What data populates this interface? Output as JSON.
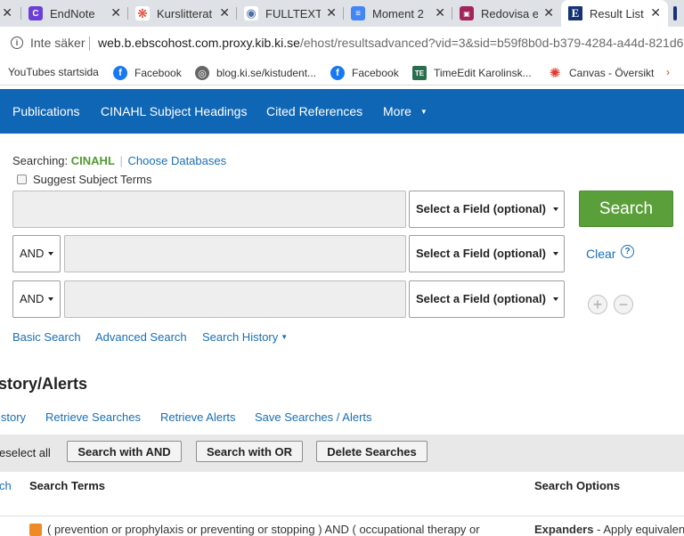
{
  "browser": {
    "tabs": [
      {
        "label": "EndNote",
        "icon": "C",
        "color": "#6a3fd8"
      },
      {
        "label": "Kurslitterat",
        "icon": "❋",
        "color": "#e0392c"
      },
      {
        "label": "FULLTEXT",
        "icon": "◉",
        "color": "#4a6fa5"
      },
      {
        "label": "Moment 2",
        "icon": "≡",
        "color": "#4285f4"
      },
      {
        "label": "Redovisa e",
        "icon": "▣",
        "color": "#a3245a"
      },
      {
        "label": "Result List",
        "icon": "E",
        "color": "#16337a"
      }
    ],
    "address": {
      "security_label": "Inte säker",
      "host": "web.b.ebscohost.com.proxy.kib.ki.se",
      "path": "/ehost/resultsadvanced?vid=3&sid=b59f8b0d-b379-4284-a44d-821d6"
    },
    "bookmarks": [
      {
        "label": "YouTubes startsida"
      },
      {
        "label": "Facebook",
        "icon": "f",
        "color": "#1877f2"
      },
      {
        "label": "blog.ki.se/kistudent...",
        "icon": "◎",
        "color": "#666666"
      },
      {
        "label": "Facebook",
        "icon": "f",
        "color": "#1877f2"
      },
      {
        "label": "TimeEdit Karolinsk...",
        "icon": "TE",
        "color": "#2a6e4f"
      },
      {
        "label": "Canvas - Översikt",
        "icon": "✺",
        "color": "#e0392c"
      }
    ]
  },
  "nav": {
    "items": [
      "Publications",
      "CINAHL Subject Headings",
      "Cited References",
      "More"
    ]
  },
  "search": {
    "searching_label": "Searching:",
    "database": "CINAHL",
    "choose_databases": "Choose Databases",
    "suggest_subject_terms": "Suggest Subject Terms",
    "field_placeholder": "Select a Field (optional)",
    "boolean_operator": "AND",
    "search_button": "Search",
    "clear": "Clear",
    "help_icon": "?",
    "links": {
      "basic": "Basic Search",
      "advanced": "Advanced Search",
      "history": "Search History"
    }
  },
  "history": {
    "title": "story/Alerts",
    "links": [
      "istory",
      "Retrieve Searches",
      "Retrieve Alerts",
      "Save Searches / Alerts"
    ],
    "deselect_all": "eselect all",
    "buttons": {
      "and": "Search with AND",
      "or": "Search with OR",
      "delete": "Delete Searches"
    },
    "headers": {
      "id": "ch",
      "terms": "Search Terms",
      "options": "Search Options"
    },
    "row": {
      "terms": "( prevention or prophylaxis or preventing or stopping ) AND ( occupational therapy or",
      "options_label": "Expanders",
      "options_value": " - Apply equivalen"
    }
  },
  "colors": {
    "nav": "#0f66b5",
    "link": "#1a6fb5",
    "search_button": "#5b9f3a",
    "database": "#4f9a2e"
  }
}
